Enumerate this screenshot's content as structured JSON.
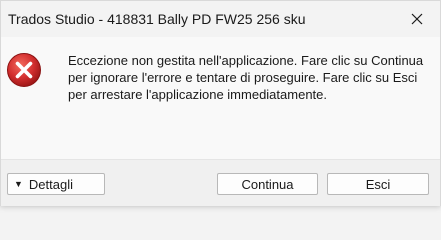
{
  "window": {
    "title": "Trados Studio - 418831 Bally PD FW25 256 sku"
  },
  "dialog": {
    "message": "Eccezione non gestita nell'applicazione. Fare clic su Continua per ignorare l'errore e tentare di proseguire. Fare clic su Esci per arrestare l'applicazione immediatamente.",
    "icon": "error-icon",
    "accent_color": "#d32f2f"
  },
  "buttons": {
    "details_label": "Dettagli",
    "continue_label": "Continua",
    "exit_label": "Esci"
  }
}
